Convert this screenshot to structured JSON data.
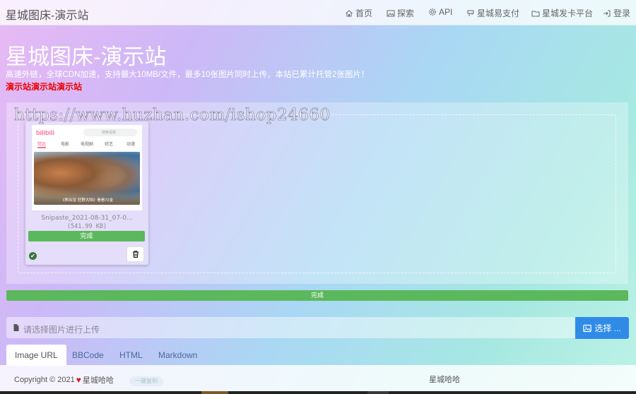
{
  "navbar": {
    "brand": "星城图床-演示站",
    "items": [
      {
        "label": "首页",
        "icon": "home-icon"
      },
      {
        "label": "探索",
        "icon": "image-icon"
      },
      {
        "label": "API",
        "icon": "gear-icon"
      },
      {
        "label": "星城易支付",
        "icon": "pay-icon"
      },
      {
        "label": "星城发卡平台",
        "icon": "folder-icon"
      },
      {
        "label": "登录",
        "icon": "login-icon"
      }
    ]
  },
  "hero": {
    "title": "星城图床-演示站",
    "subtitle": "高速外链，全球CDN加速，支持最大10MB/文件，最多10张图片同时上传，本站已累计托管2张图片！",
    "notice": "演示站演示站演示站"
  },
  "watermark": "https://www.huzhan.com/ishop24660",
  "upload": {
    "file_name": "Snipaste_2021-08-31_07-0...",
    "file_size": "(541.99 KB)",
    "card_status": "完成",
    "overall_status": "完成",
    "overall_progress": 1.0,
    "thumbnail": {
      "logo": "bilibili",
      "search_placeholder": "搜索视频",
      "tabs": [
        "精选",
        "电影",
        "电视剧",
        "综艺",
        "动漫"
      ],
      "caption": "《熊出没·狂野大陆》看看72金"
    }
  },
  "select": {
    "placeholder": "请选择图片进行上传",
    "button": "选择 ..."
  },
  "tabs": [
    "Image URL",
    "BBCode",
    "HTML",
    "Markdown"
  ],
  "active_tab": "Image URL",
  "footer": {
    "copyright_prefix": "Copyright © 2021",
    "copyright_owner": "星城哈哈",
    "right_text": "星城哈哈",
    "pill": "一键复制"
  },
  "colors": {
    "success": "#5cb85c",
    "primary": "#2f8be6",
    "notice_red": "#e00000"
  }
}
